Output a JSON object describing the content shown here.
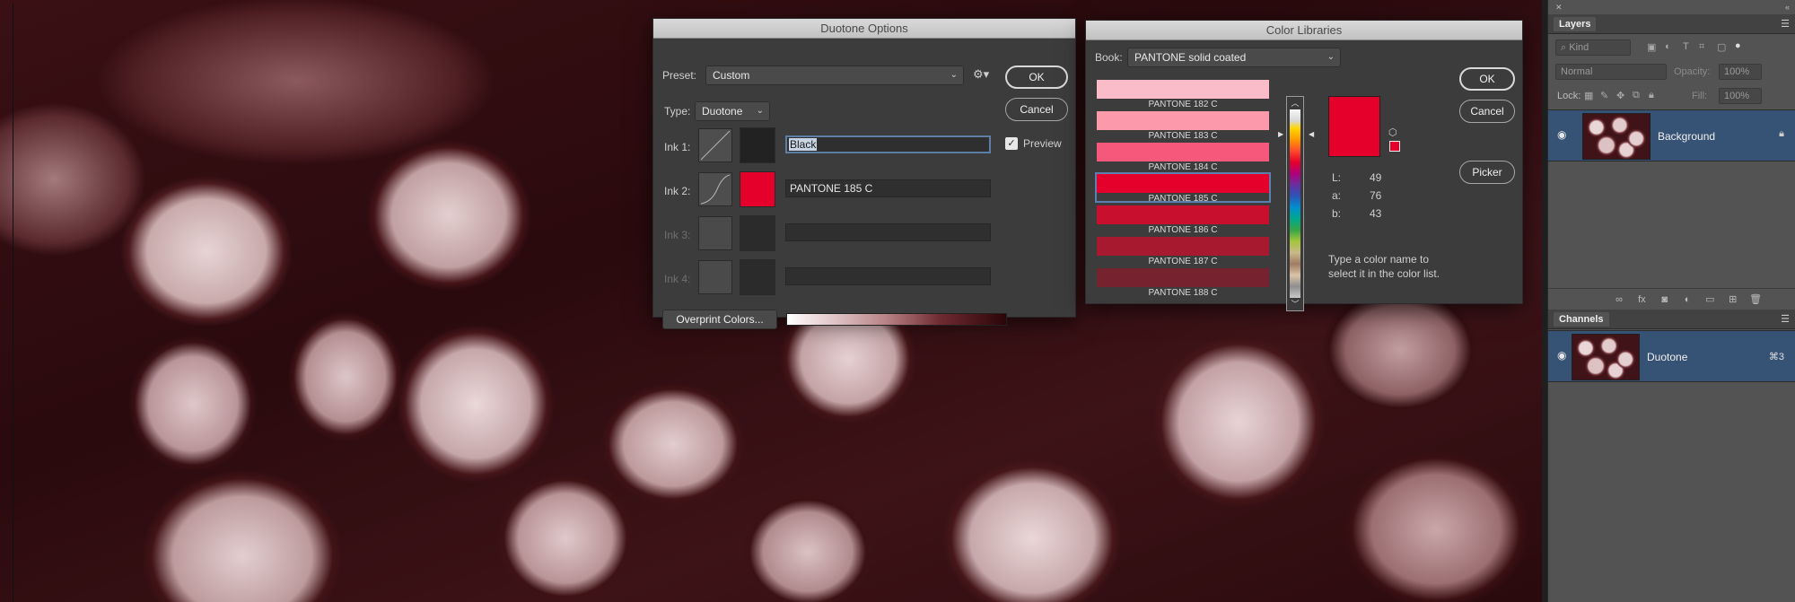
{
  "duotone": {
    "title": "Duotone Options",
    "preset_label": "Preset:",
    "preset_value": "Custom",
    "type_label": "Type:",
    "type_value": "Duotone",
    "ok": "OK",
    "cancel": "Cancel",
    "preview_label": "Preview",
    "preview_checked": true,
    "inks": [
      {
        "label": "Ink 1:",
        "name": "Black",
        "color": "#222222"
      },
      {
        "label": "Ink 2:",
        "name": "PANTONE 185 C",
        "color": "#e4002b"
      },
      {
        "label": "Ink 3:",
        "name": "",
        "color": ""
      },
      {
        "label": "Ink 4:",
        "name": "",
        "color": ""
      }
    ],
    "overprint_label": "Overprint Colors..."
  },
  "color_libraries": {
    "title": "Color Libraries",
    "book_label": "Book:",
    "book_value": "PANTONE solid coated",
    "ok": "OK",
    "cancel": "Cancel",
    "picker": "Picker",
    "colors": [
      {
        "name": "PANTONE 182 C",
        "hex": "#f9bcc8"
      },
      {
        "name": "PANTONE 183 C",
        "hex": "#fc9aab"
      },
      {
        "name": "PANTONE 184 C",
        "hex": "#f6587c"
      },
      {
        "name": "PANTONE 185 C",
        "hex": "#e4002b"
      },
      {
        "name": "PANTONE 186 C",
        "hex": "#c8102e"
      },
      {
        "name": "PANTONE 187 C",
        "hex": "#a6192e"
      },
      {
        "name": "PANTONE 188 C",
        "hex": "#76232f"
      }
    ],
    "selected_index": 3,
    "preview_color": "#e4002b",
    "lab": [
      {
        "label": "L:",
        "value": "49"
      },
      {
        "label": "a:",
        "value": "76"
      },
      {
        "label": "b:",
        "value": "43"
      }
    ],
    "hint": "Type a color name to select it in the color list."
  },
  "layers": {
    "tab": "Layers",
    "kind_placeholder": "Kind",
    "blend_mode": "Normal",
    "opacity_label": "Opacity:",
    "opacity_value": "100%",
    "lock_label": "Lock:",
    "fill_label": "Fill:",
    "fill_value": "100%",
    "items": [
      {
        "name": "Background",
        "locked": true
      }
    ]
  },
  "channels": {
    "tab": "Channels",
    "items": [
      {
        "name": "Duotone",
        "shortcut": "⌘3"
      }
    ]
  }
}
